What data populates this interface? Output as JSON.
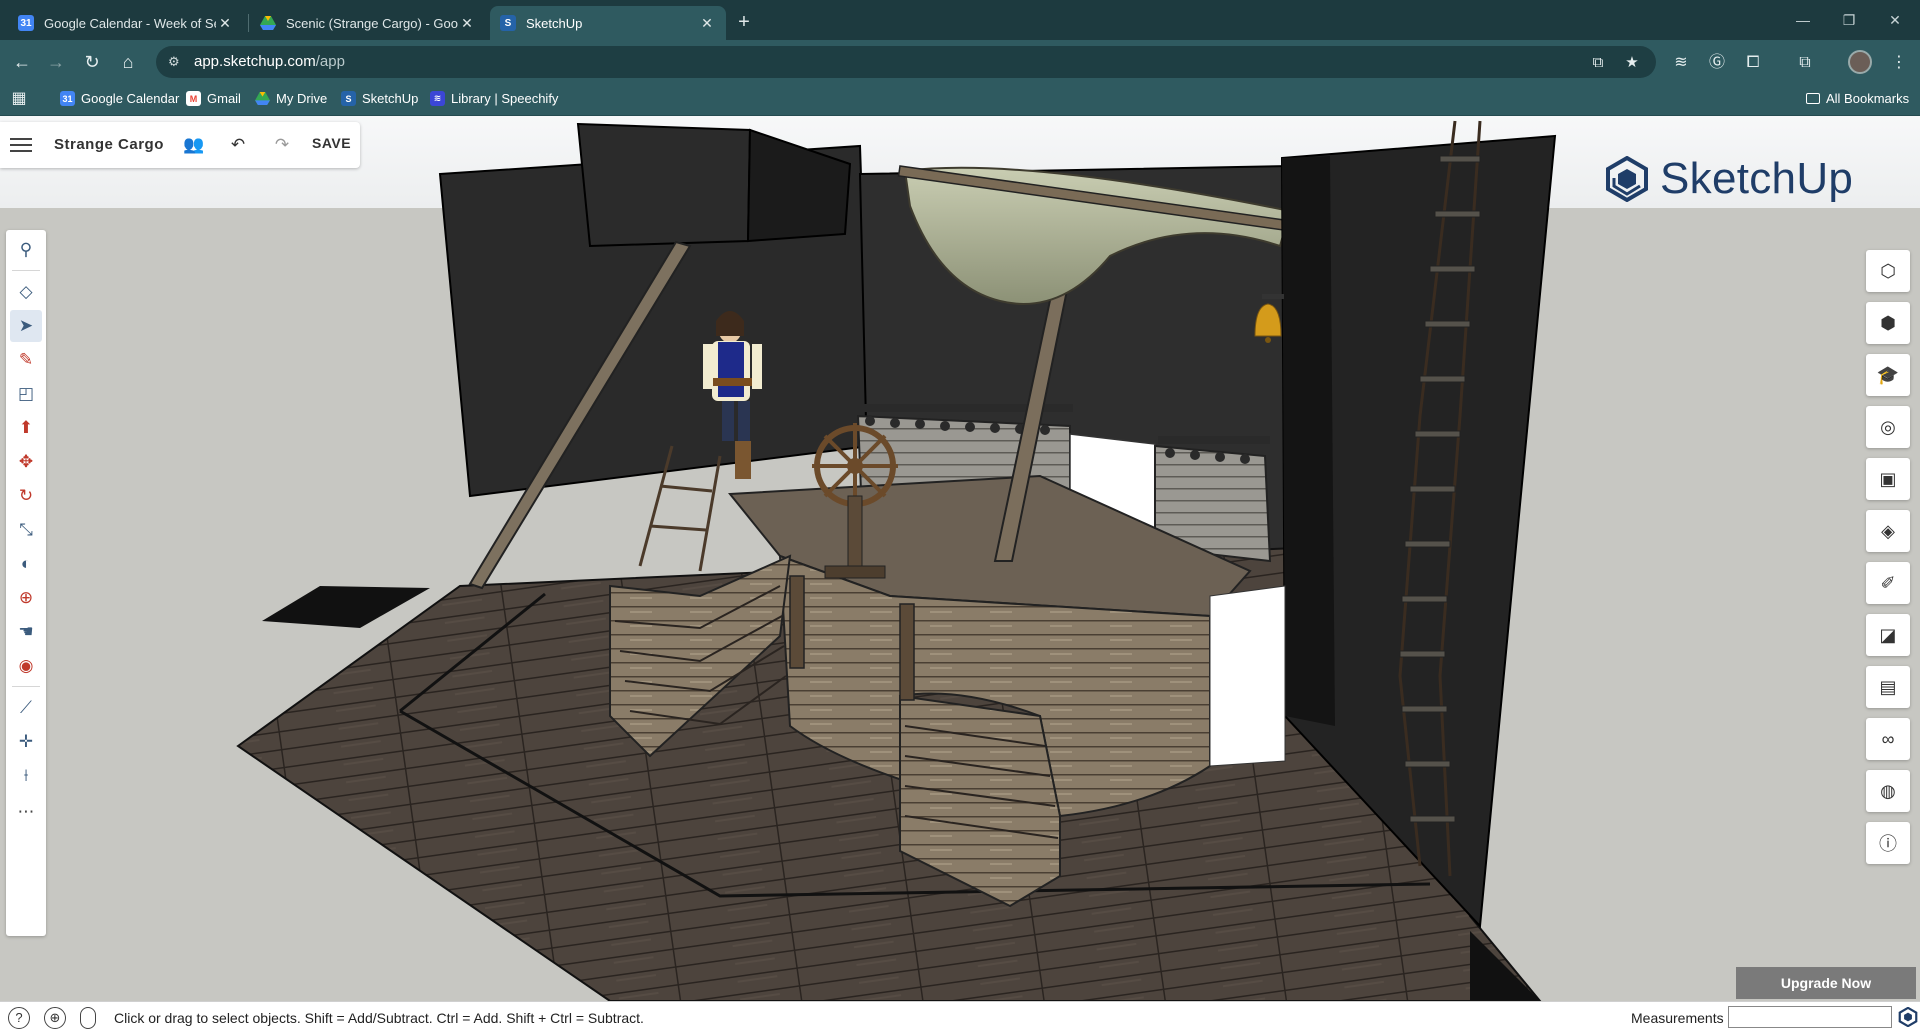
{
  "browser": {
    "tabs": [
      {
        "title": "Google Calendar - Week of Sep",
        "icon": "calendar-icon",
        "active": false
      },
      {
        "title": "Scenic (Strange Cargo) - Googl",
        "icon": "drive-icon",
        "active": false
      },
      {
        "title": "SketchUp",
        "icon": "sketchup-icon",
        "active": true
      }
    ],
    "new_tab": "+",
    "url_host": "app.sketchup.com",
    "url_path": "/app",
    "bookmarks": [
      {
        "label": "Google Calendar",
        "icon": "calendar-icon",
        "color": "#4285f4"
      },
      {
        "label": "Gmail",
        "icon": "gmail-icon",
        "color": "#ea4335"
      },
      {
        "label": "My Drive",
        "icon": "drive-icon",
        "color": "#34a853"
      },
      {
        "label": "SketchUp",
        "icon": "sketchup-icon",
        "color": "#2563a8"
      },
      {
        "label": "Library | Speechify",
        "icon": "speechify-icon",
        "color": "#3b46d6"
      }
    ],
    "all_bookmarks": "All Bookmarks"
  },
  "app": {
    "model_name": "Strange Cargo",
    "save_label": "SAVE",
    "brand": "SketchUp",
    "upgrade_label": "Upgrade Now",
    "status_text": "Click or drag to select objects. Shift = Add/Subtract. Ctrl = Add. Shift + Ctrl = Subtract.",
    "measurements_label": "Measurements",
    "measurements_value": "",
    "accent": "#1f3d68"
  },
  "left_tools": [
    {
      "name": "search-tool",
      "glyph": "⚲"
    },
    {
      "name": "eraser-tool",
      "glyph": "◇"
    },
    {
      "name": "select-tool",
      "glyph": "➤"
    },
    {
      "name": "pencil-tool",
      "glyph": "✎"
    },
    {
      "name": "rectangle-tool",
      "glyph": "◰"
    },
    {
      "name": "push-pull-tool",
      "glyph": "⬆"
    },
    {
      "name": "move-tool",
      "glyph": "✥"
    },
    {
      "name": "rotate-tool",
      "glyph": "↻"
    },
    {
      "name": "scale-tool",
      "glyph": "⤡"
    },
    {
      "name": "paint-bucket-tool",
      "glyph": "◐"
    },
    {
      "name": "section-plane-tool",
      "glyph": "⊕"
    },
    {
      "name": "pan-tool",
      "glyph": "☚"
    },
    {
      "name": "orbit-tool",
      "glyph": "◉"
    },
    {
      "name": "tape-measure-tool",
      "glyph": "⟋"
    },
    {
      "name": "axes-tool",
      "glyph": "✛"
    },
    {
      "name": "eyedropper-tool",
      "glyph": "⟊"
    },
    {
      "name": "more-tools",
      "glyph": "⋯"
    }
  ],
  "right_panels": [
    {
      "name": "entity-info-panel",
      "glyph": "⬡"
    },
    {
      "name": "components-panel",
      "glyph": "⬢"
    },
    {
      "name": "instructor-panel",
      "glyph": "🎓"
    },
    {
      "name": "outliner-panel",
      "glyph": "◎"
    },
    {
      "name": "views-panel",
      "glyph": "▣"
    },
    {
      "name": "styles-panel",
      "glyph": "◈"
    },
    {
      "name": "materials-panel",
      "glyph": "✐"
    },
    {
      "name": "tags-panel",
      "glyph": "◪"
    },
    {
      "name": "scenes-panel",
      "glyph": "▤"
    },
    {
      "name": "display-panel",
      "glyph": "∞"
    },
    {
      "name": "solar-panel",
      "glyph": "◍"
    },
    {
      "name": "info-panel",
      "glyph": "ⓘ"
    }
  ]
}
